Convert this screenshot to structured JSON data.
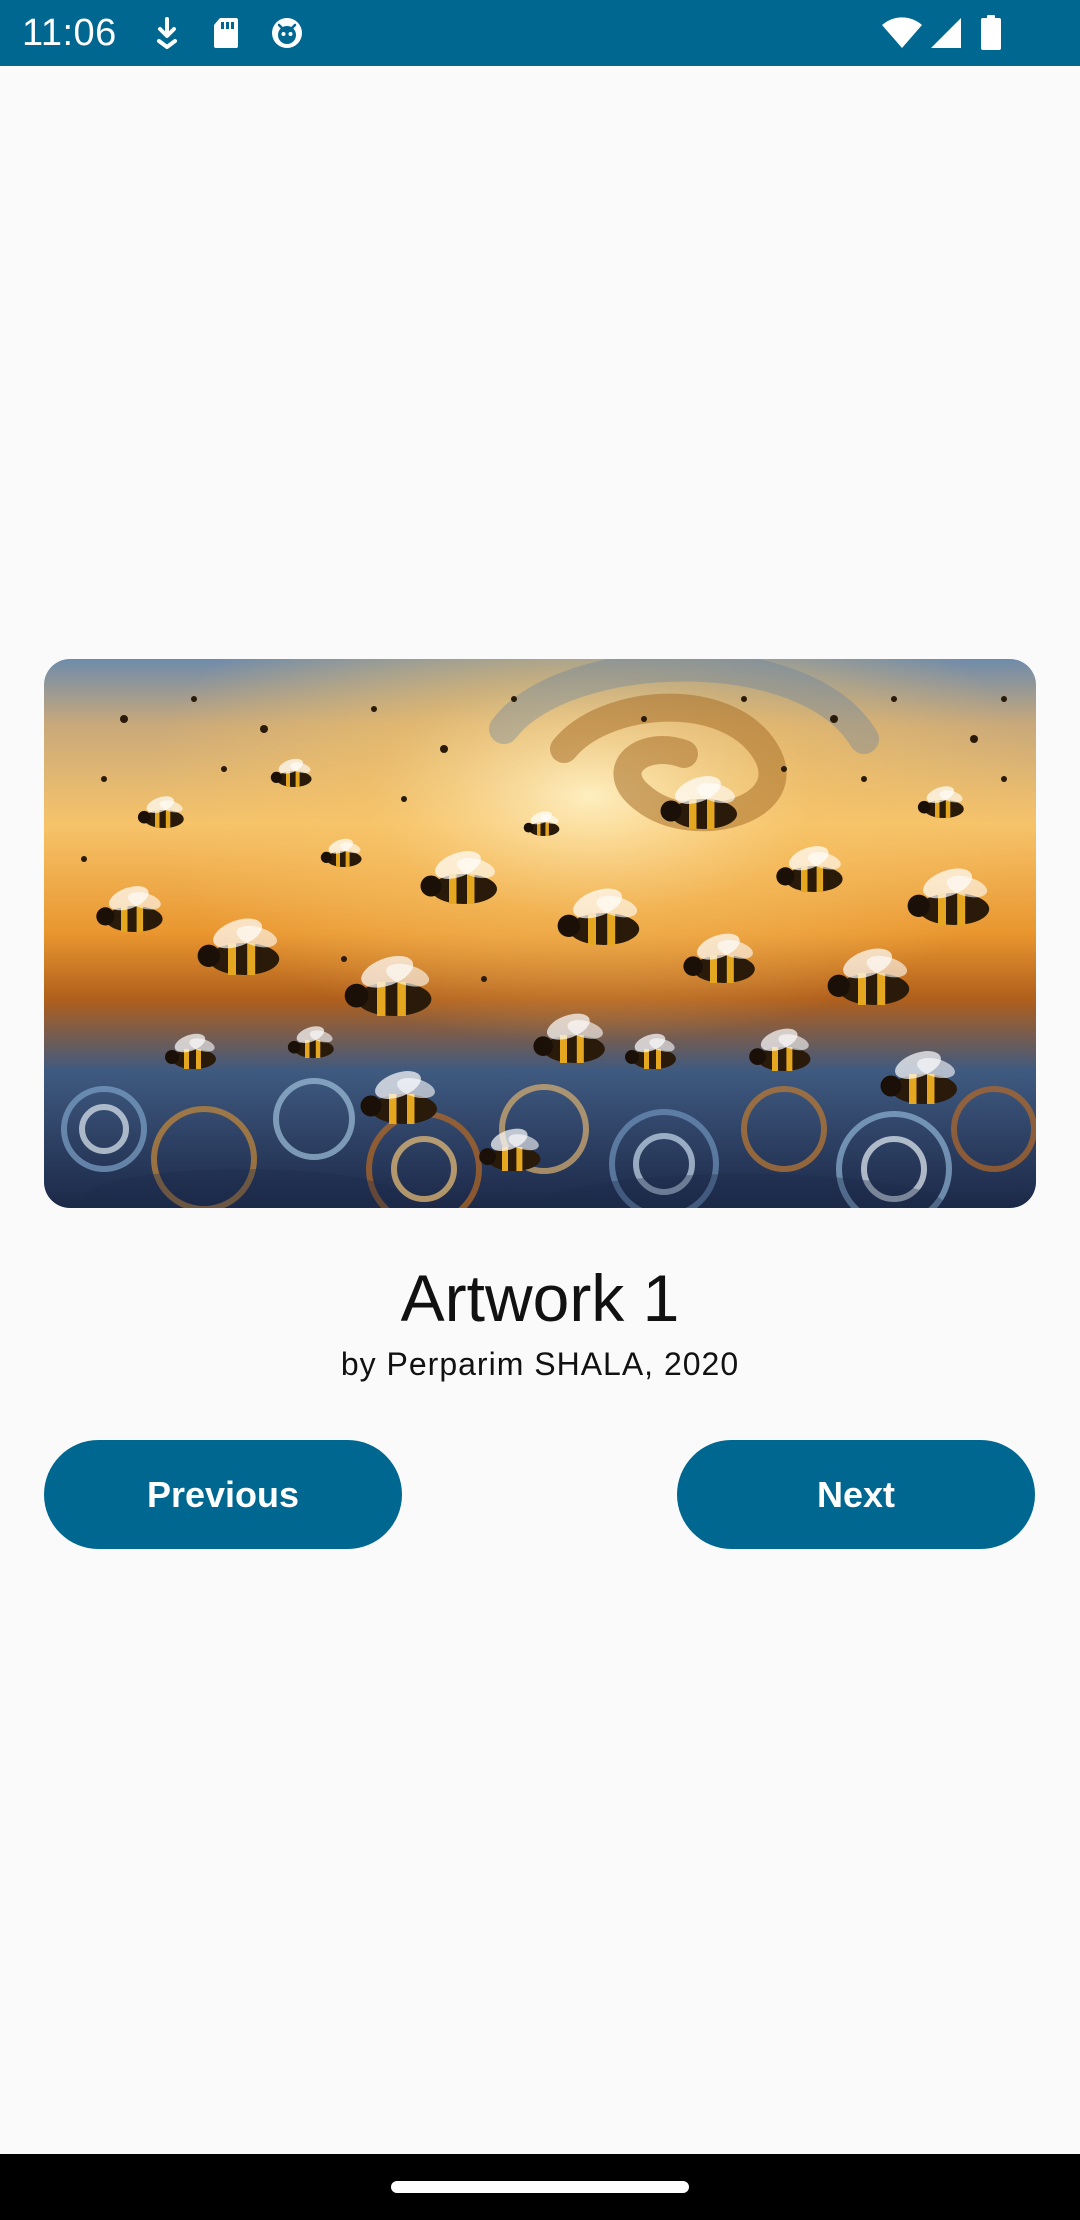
{
  "status_bar": {
    "time": "11:06",
    "left_icons": [
      "download-icon",
      "sd-card-icon",
      "android-debug-icon"
    ],
    "right_icons": [
      "wifi-icon",
      "cellular-signal-icon",
      "battery-icon"
    ],
    "background": "#006890"
  },
  "artwork": {
    "image_icon": "swarm-of-bees-painting",
    "title": "Artwork 1",
    "artist_line": "by Perparim SHALA, 2020"
  },
  "buttons": {
    "previous_label": "Previous",
    "next_label": "Next",
    "color": "#006890"
  },
  "colors": {
    "accent": "#006890",
    "background": "#fafafa",
    "text": "#111111"
  }
}
